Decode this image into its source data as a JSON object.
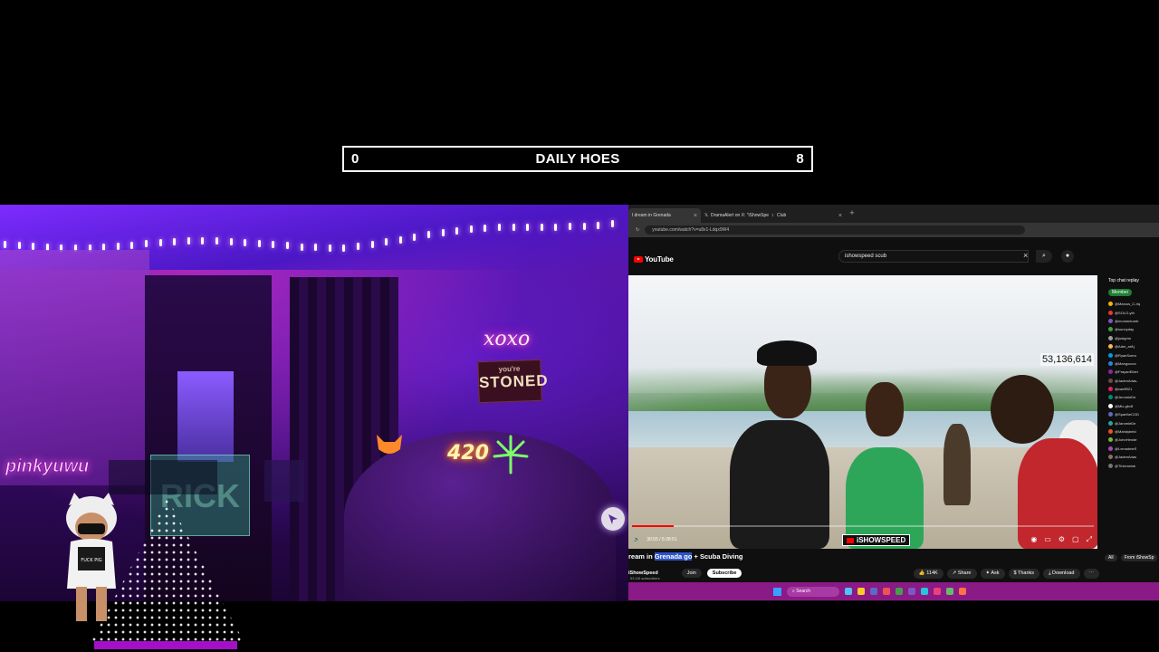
{
  "scoreboard": {
    "left_score": "0",
    "title": "DAILY HOES",
    "right_score": "8"
  },
  "webcam": {
    "neon_sign_1": "xoxo",
    "sign_line_1": "you're",
    "sign_line_2": "STONED",
    "neon_sign_2": "420",
    "brand_text": "pinkyuwu",
    "card_text": "RICK",
    "avatar_shirt": "FUCK PIG",
    "panel_rows": [
      "",
      "",
      ""
    ],
    "names": [
      "",
      "",
      "",
      "",
      ""
    ]
  },
  "browser": {
    "tabs": [
      {
        "label": "l dream in Grenada",
        "active": true
      },
      {
        "label": "DramaAlert on X: \"iShowSpe",
        "active": false
      },
      {
        "label": "Club",
        "active": false
      }
    ],
    "url": "youtube.com/watch?v=u8x1-Ldqx9W4",
    "youtube_label": "YouTube",
    "search_value": "ishowspeed scub",
    "video": {
      "view_count": "53,136,614",
      "channel_tag": "iSHOWSPEED",
      "time": "30:55 / 5:28:51",
      "progress": 0.09,
      "title_prefix": "ream in ",
      "title_highlight": "Grenada go",
      "title_suffix": " + Scuba Diving",
      "channel": "iShowSpeed",
      "subscribers": "53.1M subscribers",
      "join_label": "Join",
      "subscribe_label": "Subscribe",
      "likes": "114K",
      "share_label": "Share",
      "ask_label": "Ask",
      "thanks_label": "Thanks",
      "download_label": "Download"
    },
    "chat": {
      "header": "Top chat replay",
      "member_label": "Member",
      "tab_all": "All",
      "tab_from": "From iShowSp",
      "messages": [
        {
          "user": "@Marcus_C-rlq",
          "color": "#f4b400"
        },
        {
          "user": "@SOLO-yth",
          "color": "#e53935"
        },
        {
          "user": "@momentumb",
          "color": "#7e57c2"
        },
        {
          "user": "@sunnyday",
          "color": "#43a047"
        },
        {
          "user": "@justgrim",
          "color": "#9e9e9e"
        },
        {
          "user": "@Adm_arif-j",
          "color": "#ffb74d"
        },
        {
          "user": "@RyanSuero",
          "color": "#039be5"
        },
        {
          "user": "@Mangocorc",
          "color": "#1e88e5"
        },
        {
          "user": "@PrayanElder",
          "color": "#8e24aa"
        },
        {
          "user": "@JadenArias-",
          "color": "#6d4c41"
        },
        {
          "user": "@caeff921",
          "color": "#e91e63"
        },
        {
          "user": "@JeromieDe",
          "color": "#00897b"
        },
        {
          "user": "@Mix-gfx4f",
          "color": "#ffffff"
        },
        {
          "user": "@SpartheCOD",
          "color": "#5c6bc0"
        },
        {
          "user": "@JaromieDe",
          "color": "#26a69a"
        },
        {
          "user": "@Mahdybeld",
          "color": "#f4511e"
        },
        {
          "user": "@JohnHende",
          "color": "#7cb342"
        },
        {
          "user": "@LxmadmeS",
          "color": "#ab47bc"
        },
        {
          "user": "@JadenArias",
          "color": "#8d6e63"
        },
        {
          "user": "@Tinkerwink",
          "color": "#757575"
        }
      ]
    }
  },
  "taskbar": {
    "search_label": "Search"
  },
  "colors": {
    "accent_purple": "#a40fc8",
    "youtube_red": "#ff0000",
    "taskbar": "#8a1a86"
  }
}
